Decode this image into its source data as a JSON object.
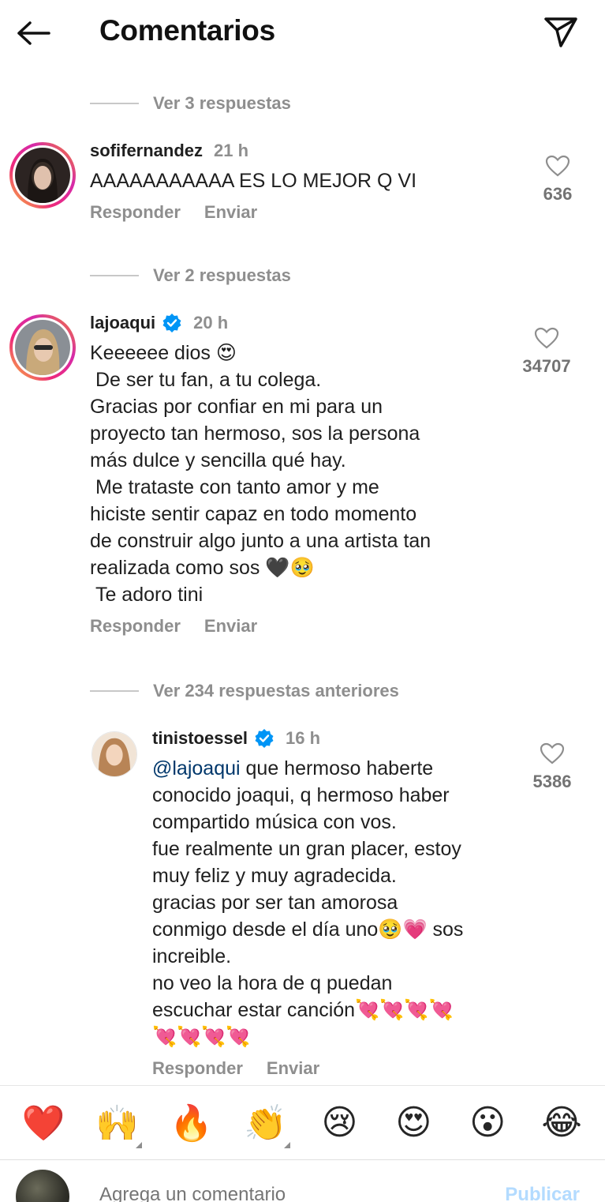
{
  "header": {
    "title": "Comentarios"
  },
  "threads": [
    {
      "view_replies": "Ver 3 respuestas",
      "username": "sofifernandez",
      "time": "21 h",
      "text": "AAAAAAAAAAA ES LO MEJOR Q VI",
      "likes": "636",
      "reply_label": "Responder",
      "send_label": "Enviar"
    },
    {
      "view_replies": "Ver 2 respuestas",
      "username": "lajoaqui",
      "verified": true,
      "time": "20 h",
      "text": "Keeeeee dios 😍\n De ser tu fan, a tu colega.\nGracias por confiar en mi para un\nproyecto tan hermoso, sos la persona\nmás dulce y sencilla qué hay.\n Me trataste con tanto amor y me\nhiciste sentir capaz en todo momento\nde construir algo junto a una artista tan\nrealizada como sos 🖤🥹\n Te adoro tini",
      "likes": "34707",
      "reply_label": "Responder",
      "send_label": "Enviar"
    }
  ],
  "reply": {
    "view_previous": "Ver 234 respuestas anteriores",
    "username": "tinistoessel",
    "verified": true,
    "time": "16 h",
    "mention": "@lajoaqui",
    "text": " que hermoso haberte\nconocido joaqui, q hermoso haber\ncompartido música con vos.\nfue realmente un gran placer, estoy\nmuy feliz y muy agradecida.\ngracias por ser tan amorosa\nconmigo desde el día uno🥹💗 sos\nincreible.\nno veo la hora de q puedan\nescuchar estar canción💘💘💘💘\n💘💘💘💘",
    "likes": "5386",
    "reply_label": "Responder",
    "send_label": "Enviar"
  },
  "emoji_bar": [
    {
      "glyph": "❤️",
      "name": "red-heart",
      "variants": false
    },
    {
      "glyph": "🙌",
      "name": "raising-hands",
      "variants": true
    },
    {
      "glyph": "🔥",
      "name": "fire",
      "variants": false
    },
    {
      "glyph": "👏",
      "name": "clapping-hands",
      "variants": true
    },
    {
      "glyph": "😢",
      "name": "crying-face",
      "variants": false
    },
    {
      "glyph": "😍",
      "name": "heart-eyes",
      "variants": false
    },
    {
      "glyph": "😮",
      "name": "surprised-face",
      "variants": false
    },
    {
      "glyph": "😂",
      "name": "tears-of-joy",
      "variants": false
    }
  ],
  "composer": {
    "placeholder": "Agrega un comentario",
    "publish_label": "Publicar"
  },
  "colors": {
    "link": "#00376b",
    "verified": "#0095f6",
    "muted": "#8e8e8e",
    "publish": "#b3dbff"
  }
}
